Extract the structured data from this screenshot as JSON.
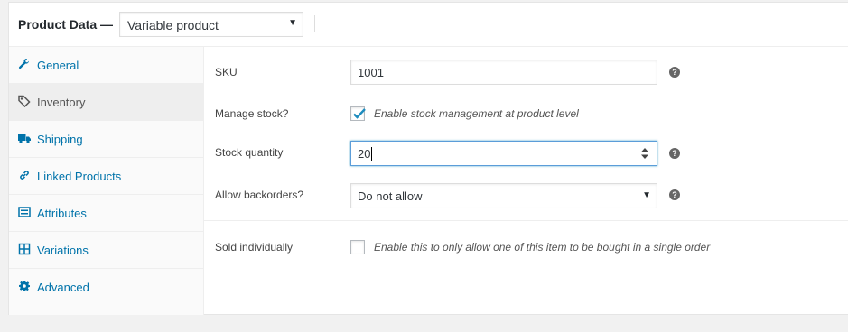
{
  "header": {
    "title": "Product Data —",
    "product_type": "Variable product"
  },
  "tabs": [
    {
      "label": "General",
      "icon": "wrench-icon"
    },
    {
      "label": "Inventory",
      "icon": "tag-icon"
    },
    {
      "label": "Shipping",
      "icon": "truck-icon"
    },
    {
      "label": "Linked Products",
      "icon": "link-icon"
    },
    {
      "label": "Attributes",
      "icon": "list-icon"
    },
    {
      "label": "Variations",
      "icon": "grid-icon"
    },
    {
      "label": "Advanced",
      "icon": "gear-icon"
    }
  ],
  "active_tab": "Inventory",
  "inventory": {
    "sku_label": "SKU",
    "sku_value": "1001",
    "manage_stock_label": "Manage stock?",
    "manage_stock_desc": "Enable stock management at product level",
    "manage_stock_checked": true,
    "stock_qty_label": "Stock quantity",
    "stock_qty_value": "20",
    "backorders_label": "Allow backorders?",
    "backorders_value": "Do not allow",
    "sold_individually_label": "Sold individually",
    "sold_individually_desc": "Enable this to only allow one of this item to be bought in a single order",
    "sold_individually_checked": false,
    "help_symbol": "?"
  },
  "colors": {
    "link": "#0073aa",
    "active_tab_bg": "#eeeeee",
    "check": "#1e8cbe",
    "focus_border": "#5b9dd9"
  }
}
